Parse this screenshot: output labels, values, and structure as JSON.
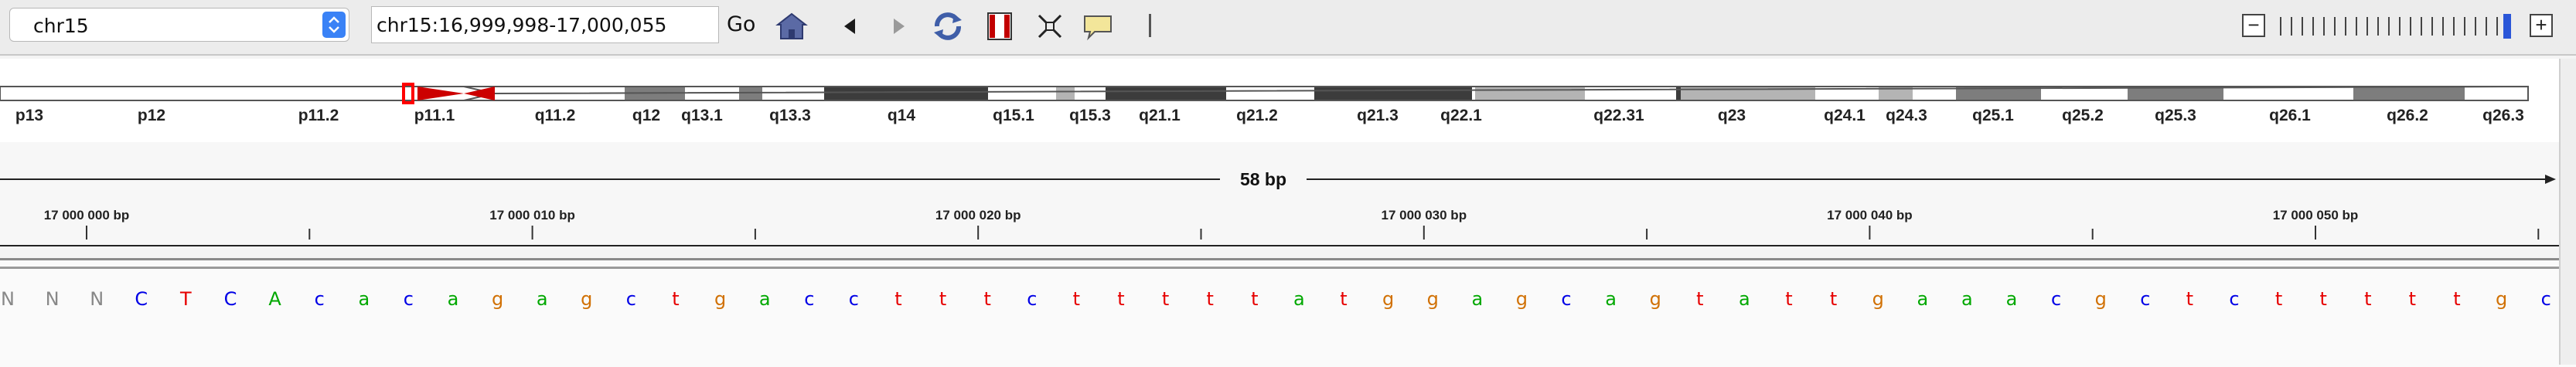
{
  "toolbar": {
    "chromosome": "chr15",
    "locus": "chr15:16,999,998-17,000,055",
    "go_label": "Go",
    "icons": [
      "home-icon",
      "back-arrow-icon",
      "forward-arrow-icon",
      "refresh-icon",
      "region-of-interest-icon",
      "resize-to-window-icon",
      "popup-text-icon"
    ],
    "zoom_out_label": "−",
    "zoom_in_label": "+"
  },
  "ideogram": {
    "bands": [
      "p13",
      "p12",
      "p11.2",
      "p11.1",
      "q11.2",
      "q12",
      "q13.1",
      "q13.3",
      "q14",
      "q15.1",
      "q15.3",
      "q21.1",
      "q21.2",
      "q21.3",
      "q22.1",
      "q22.31",
      "q23",
      "q24.1",
      "q24.3",
      "q25.1",
      "q25.2",
      "q25.3",
      "q26.1",
      "q26.2",
      "q26.3"
    ],
    "colors": {
      "band_dark": "#3c3c3c",
      "band_mid": "#7d7d7d",
      "band_light": "#b4b4b4",
      "centromere": "#cc0000",
      "current_region": "#ff0000"
    }
  },
  "ruler": {
    "span_label": "58 bp",
    "tick_labels": [
      "17 000 000 bp",
      "17 000 010 bp",
      "17 000 020 bp",
      "17 000 030 bp",
      "17 000 040 bp",
      "17 000 050 bp"
    ]
  },
  "sequence": {
    "bases": [
      "N",
      "N",
      "N",
      "C",
      "T",
      "C",
      "A",
      "c",
      "a",
      "c",
      "a",
      "g",
      "a",
      "g",
      "c",
      "t",
      "g",
      "a",
      "c",
      "c",
      "t",
      "t",
      "t",
      "c",
      "t",
      "t",
      "t",
      "t",
      "t",
      "a",
      "t",
      "g",
      "g",
      "a",
      "g",
      "c",
      "a",
      "g",
      "t",
      "a",
      "t",
      "t",
      "g",
      "a",
      "a",
      "a",
      "c",
      "g",
      "c",
      "t",
      "c",
      "t",
      "t",
      "t",
      "t",
      "t",
      "g",
      "c",
      "c"
    ],
    "colors": {
      "A": "#00a800",
      "C": "#0000e6",
      "G": "#d17105",
      "T": "#e60000",
      "N": "#888888"
    }
  }
}
